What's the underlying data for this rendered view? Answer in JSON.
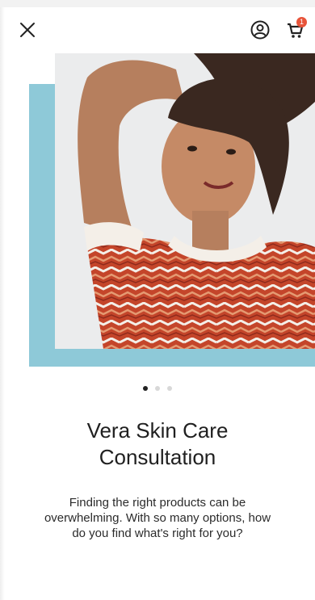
{
  "header": {
    "close_icon": "close-icon",
    "account_icon": "account-icon",
    "cart_icon": "cart-icon",
    "cart_count": "1",
    "badge_color": "#e8543a"
  },
  "carousel": {
    "slide_count": 3,
    "active_index": 0,
    "accent_color": "#8ec9d8"
  },
  "content": {
    "title_line1": "Vera Skin Care",
    "title_line2": "Consultation",
    "desc_line1": "Finding the right products can be",
    "desc_line2": "overwhelming. With so many options, how",
    "desc_line3": "do you find what's right for you?"
  }
}
